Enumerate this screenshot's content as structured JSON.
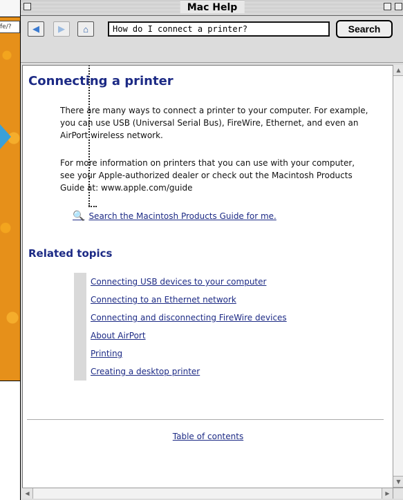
{
  "window": {
    "title": "Mac Help"
  },
  "toolbar": {
    "search_value": "How do I connect a printer?",
    "search_button": "Search"
  },
  "page": {
    "heading": "Connecting a printer",
    "paragraph1": "There are many ways to connect a printer to your computer. For example, you can use USB (Universal Serial Bus), FireWire, Ethernet, and even an AirPort wireless network.",
    "paragraph2": "For more information on printers that you can use with your computer, see your Apple-authorized dealer or check out the Macintosh Products Guide at: www.apple.com/guide",
    "guide_link": "Search the Macintosh Products Guide for me.",
    "related_heading": "Related topics",
    "related_links": [
      "Connecting USB devices to your computer",
      "Connecting to an Ethernet network",
      "Connecting and disconnecting FireWire devices",
      "About AirPort",
      "Printing",
      "Creating a desktop printer"
    ],
    "toc_link": "Table of contents"
  },
  "background": {
    "field_text": "fe/?"
  },
  "colors": {
    "link": "#1c2a85",
    "desktop_accent": "#e6901a",
    "arrow": "#3aa0d8"
  },
  "icons": [
    "back-arrow-icon",
    "forward-arrow-icon",
    "home-icon",
    "magnifier-icon"
  ]
}
